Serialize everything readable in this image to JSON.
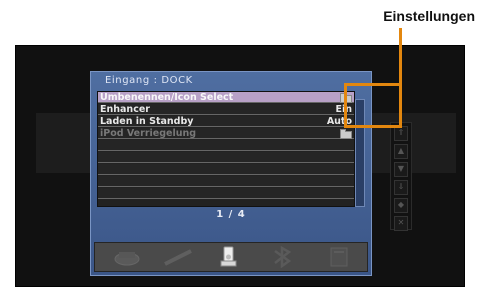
{
  "callout": {
    "label": "Einstellungen"
  },
  "panel": {
    "title": "Eingang : DOCK",
    "rows": [
      {
        "label": "Umbenennen/Icon Select",
        "value": "",
        "icon": "folder-icon"
      },
      {
        "label": "Enhancer",
        "value": "Ein"
      },
      {
        "label": "Laden in Standby",
        "value": "Auto"
      },
      {
        "label": "iPod Verriegelung",
        "value": "",
        "icon": "folder-icon"
      }
    ],
    "page_indicator": "1 / 4",
    "input_icons": [
      "optical-disc-icon",
      "cable-icon",
      "ipod-dock-icon",
      "bluetooth-icon",
      "network-icon"
    ],
    "side_arrows": [
      "⇑",
      "▲",
      "▼",
      "⇓",
      "◆",
      "✕"
    ]
  },
  "colors": {
    "accent": "#e3870f",
    "panel": "#4a6596",
    "selected_row": "#b8a1c7"
  }
}
